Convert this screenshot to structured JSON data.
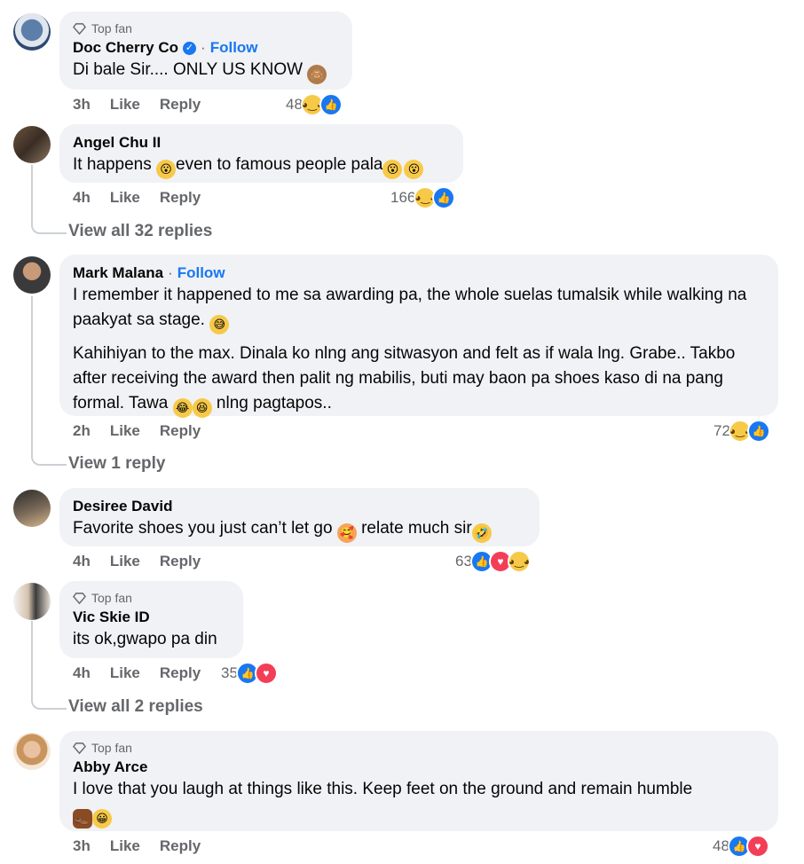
{
  "colors": {
    "link": "#1877f2",
    "muted": "#65676b",
    "bubble": "#f0f2f5",
    "like": "#1877f2",
    "love": "#f33e58",
    "haha": "#f7c948"
  },
  "labels": {
    "top_fan": "Top fan",
    "follow": "Follow",
    "like": "Like",
    "reply": "Reply",
    "dot": "·"
  },
  "comments": [
    {
      "name": "Doc Cherry Co",
      "top_fan": true,
      "verified": true,
      "follow": true,
      "text": "Di bale Sir.... ONLY US KNOW",
      "time": "3h",
      "count": "48",
      "reactions": [
        "haha",
        "like"
      ]
    },
    {
      "name": "Angel Chu II",
      "text_a": "It happens ",
      "text_b": "even to famous people pala",
      "time": "4h",
      "count": "166",
      "reactions": [
        "haha",
        "like"
      ]
    },
    {
      "name": "Mark Malana",
      "follow": true,
      "p1": "I remember it happened to me sa awarding pa, the whole suelas tumalsik while walking na paakyat sa stage.",
      "p2": "Kahihiyan to the max. Dinala ko nlng ang sitwasyon and felt as if wala lng. Grabe.. Takbo after receiving the award then palit ng mabilis, buti may baon pa shoes kaso di na pang formal. Tawa",
      "p2_end": "nlng pagtapos..",
      "time": "2h",
      "count": "72",
      "reactions": [
        "haha",
        "like"
      ]
    },
    {
      "name": "Desiree David",
      "text_a": "Favorite shoes you just can’t let go ",
      "text_b": " relate much sir",
      "time": "4h",
      "count": "63",
      "reactions": [
        "like",
        "love",
        "haha"
      ]
    },
    {
      "name": "Vic Skie ID",
      "top_fan": true,
      "text": "its ok,gwapo pa din",
      "time": "4h",
      "count": "35",
      "reactions": [
        "like",
        "love"
      ]
    },
    {
      "name": "Abby Arce",
      "top_fan": true,
      "text": "I love that you laugh at things like this. Keep feet on the ground and remain humble",
      "time": "3h",
      "count": "48",
      "reactions": [
        "like",
        "love"
      ]
    }
  ],
  "view_replies": [
    "View all 32 replies",
    "View 1 reply",
    "View all 2 replies"
  ],
  "icons": {
    "top_fan": "diamond-icon",
    "verified": "verified-check-icon",
    "like": "thumbs-up-icon",
    "love": "heart-icon",
    "haha": "laughing-face-icon"
  }
}
